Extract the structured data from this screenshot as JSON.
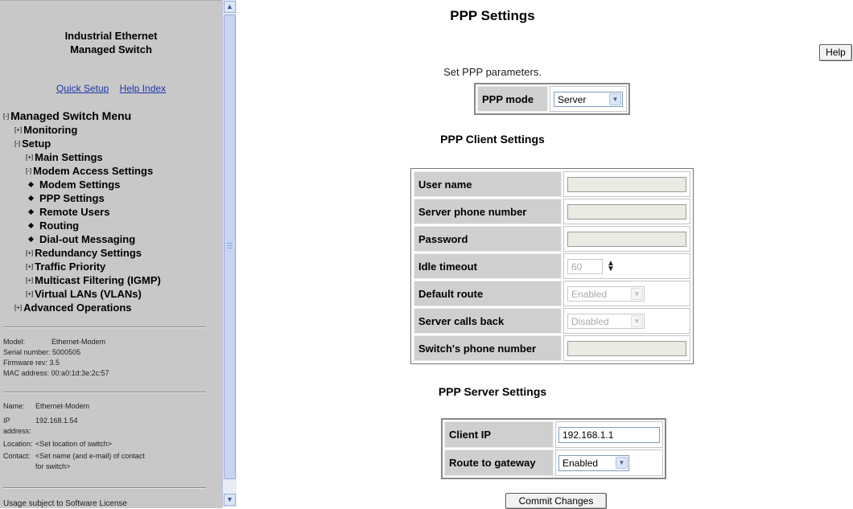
{
  "sidebar": {
    "title_line1": "Industrial Ethernet",
    "title_line2": "Managed Switch",
    "links": {
      "quick_setup": "Quick Setup",
      "help_index": "Help Index"
    },
    "menu": {
      "root": {
        "toggle": "[-]",
        "label": "Managed Switch Menu"
      },
      "monitoring": {
        "toggle": "[+]",
        "label": "Monitoring"
      },
      "setup": {
        "toggle": "[-]",
        "label": "Setup"
      },
      "main_settings": {
        "toggle": "[+]",
        "label": "Main Settings"
      },
      "modem_access": {
        "toggle": "[-]",
        "label": "Modem Access Settings"
      },
      "modem_settings": "Modem Settings",
      "ppp_settings": "PPP Settings",
      "remote_users": "Remote Users",
      "routing": "Routing",
      "dialout": "Dial-out Messaging",
      "redundancy": {
        "toggle": "[+]",
        "label": "Redundancy Settings"
      },
      "traffic": {
        "toggle": "[+]",
        "label": "Traffic Priority"
      },
      "multicast": {
        "toggle": "[+]",
        "label": "Multicast Filtering (IGMP)"
      },
      "vlans": {
        "toggle": "[+]",
        "label": "Virtual LANs (VLANs)"
      },
      "advanced": {
        "toggle": "[+]",
        "label": "Advanced Operations"
      }
    },
    "device": {
      "model_label": "Model:",
      "model": "Ethernet-Modem",
      "serial_label": "Serial number:",
      "serial": "5000505",
      "firmware_label": "Firmware rev:",
      "firmware": "3.5",
      "mac_label": "MAC address:",
      "mac": "00:a0:1d:3e:2c:57"
    },
    "config": {
      "name_label": "Name:",
      "name": "Ethernet-Modem",
      "ip_label1": "IP",
      "ip_label2": "address:",
      "ip": "192.168.1.54",
      "location_label": "Location:",
      "location": "<Set location of switch>",
      "contact_label": "Contact:",
      "contact_line1": "<Set name (and e-mail) of contact",
      "contact_line2": "for switch>"
    },
    "footer": "Usage subject to Software License"
  },
  "main": {
    "title": "PPP Settings",
    "help": "Help",
    "subtitle": "Set PPP parameters.",
    "ppp_mode": {
      "label": "PPP mode",
      "value": "Server"
    },
    "client": {
      "heading": "PPP Client Settings",
      "user_name": {
        "label": "User name",
        "value": ""
      },
      "server_phone": {
        "label": "Server phone number",
        "value": ""
      },
      "password": {
        "label": "Password",
        "value": ""
      },
      "idle_timeout": {
        "label": "Idle timeout",
        "value": "60"
      },
      "default_route": {
        "label": "Default route",
        "value": "Enabled"
      },
      "server_calls_back": {
        "label": "Server calls back",
        "value": "Disabled"
      },
      "switch_phone": {
        "label": "Switch's phone number",
        "value": ""
      }
    },
    "server": {
      "heading": "PPP Server Settings",
      "client_ip": {
        "label": "Client IP",
        "value": "192.168.1.1"
      },
      "route_to_gateway": {
        "label": "Route to gateway",
        "value": "Enabled"
      }
    },
    "commit": "Commit Changes"
  }
}
